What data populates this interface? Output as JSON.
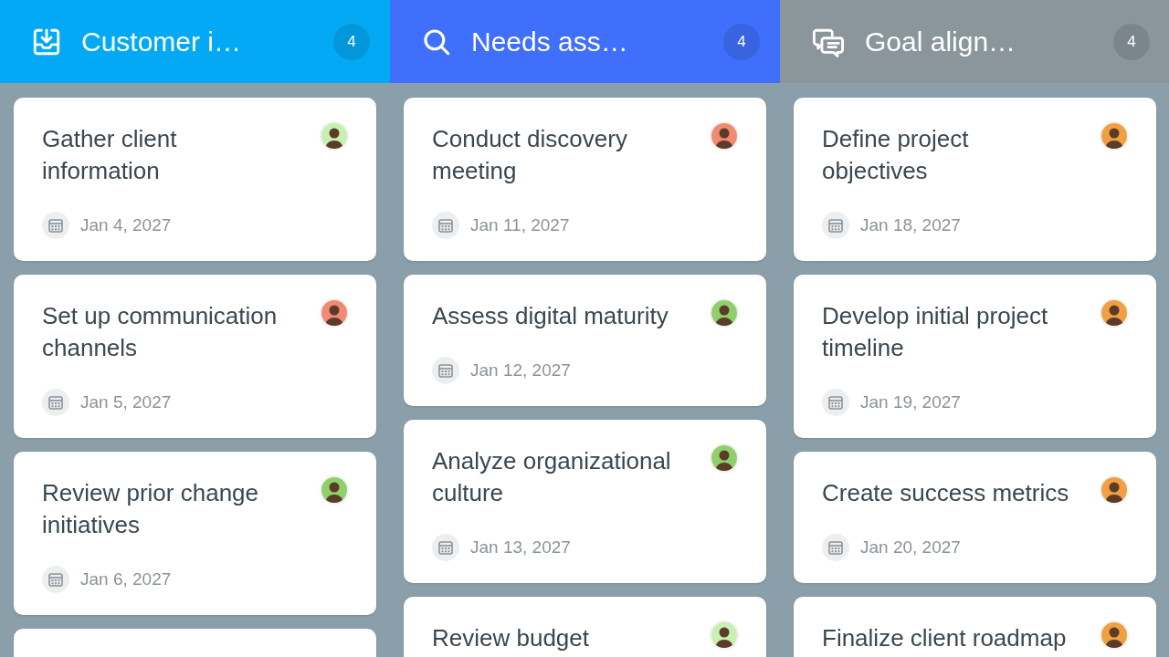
{
  "columns": [
    {
      "title": "Customer i…",
      "count": "4",
      "color": "#03a9f4",
      "cards": [
        {
          "kind": "task",
          "title": "Gather client information",
          "date": "Jan 4, 2027",
          "color": "#c8f0b0"
        },
        {
          "kind": "task",
          "title": "Set up communication channels",
          "date": "Jan 5, 2027",
          "color": "#f08a72"
        },
        {
          "kind": "task",
          "title": "Review prior change initiatives",
          "date": "Jan 6, 2027",
          "color": "#8fd06a"
        },
        {
          "kind": "cut"
        }
      ]
    },
    {
      "title": "Needs ass…",
      "count": "4",
      "color": "#3f6ffb",
      "cards": [
        {
          "kind": "task",
          "title": "Conduct discovery meeting",
          "date": "Jan 11, 2027",
          "color": "#f08a72"
        },
        {
          "kind": "task",
          "title": "Assess digital maturity",
          "date": "Jan 12, 2027",
          "color": "#8fd06a"
        },
        {
          "kind": "task",
          "title": "Analyze organizational culture",
          "date": "Jan 13, 2027",
          "color": "#8fd06a"
        },
        {
          "kind": "task",
          "title": "Review budget",
          "color": "#c8f0b0"
        }
      ]
    },
    {
      "title": "Goal align…",
      "count": "4",
      "color": "#8a969c",
      "cards": [
        {
          "kind": "task",
          "title": "Define project objectives",
          "date": "Jan 18, 2027",
          "color": "#f0a040"
        },
        {
          "kind": "task",
          "title": "Develop initial project timeline",
          "date": "Jan 19, 2027",
          "color": "#f0a040"
        },
        {
          "kind": "task",
          "title": "Create success metrics",
          "date": "Jan 20, 2027",
          "color": "#f0a040"
        },
        {
          "kind": "task",
          "title": "Finalize client roadmap",
          "color": "#f0a040"
        }
      ]
    }
  ]
}
